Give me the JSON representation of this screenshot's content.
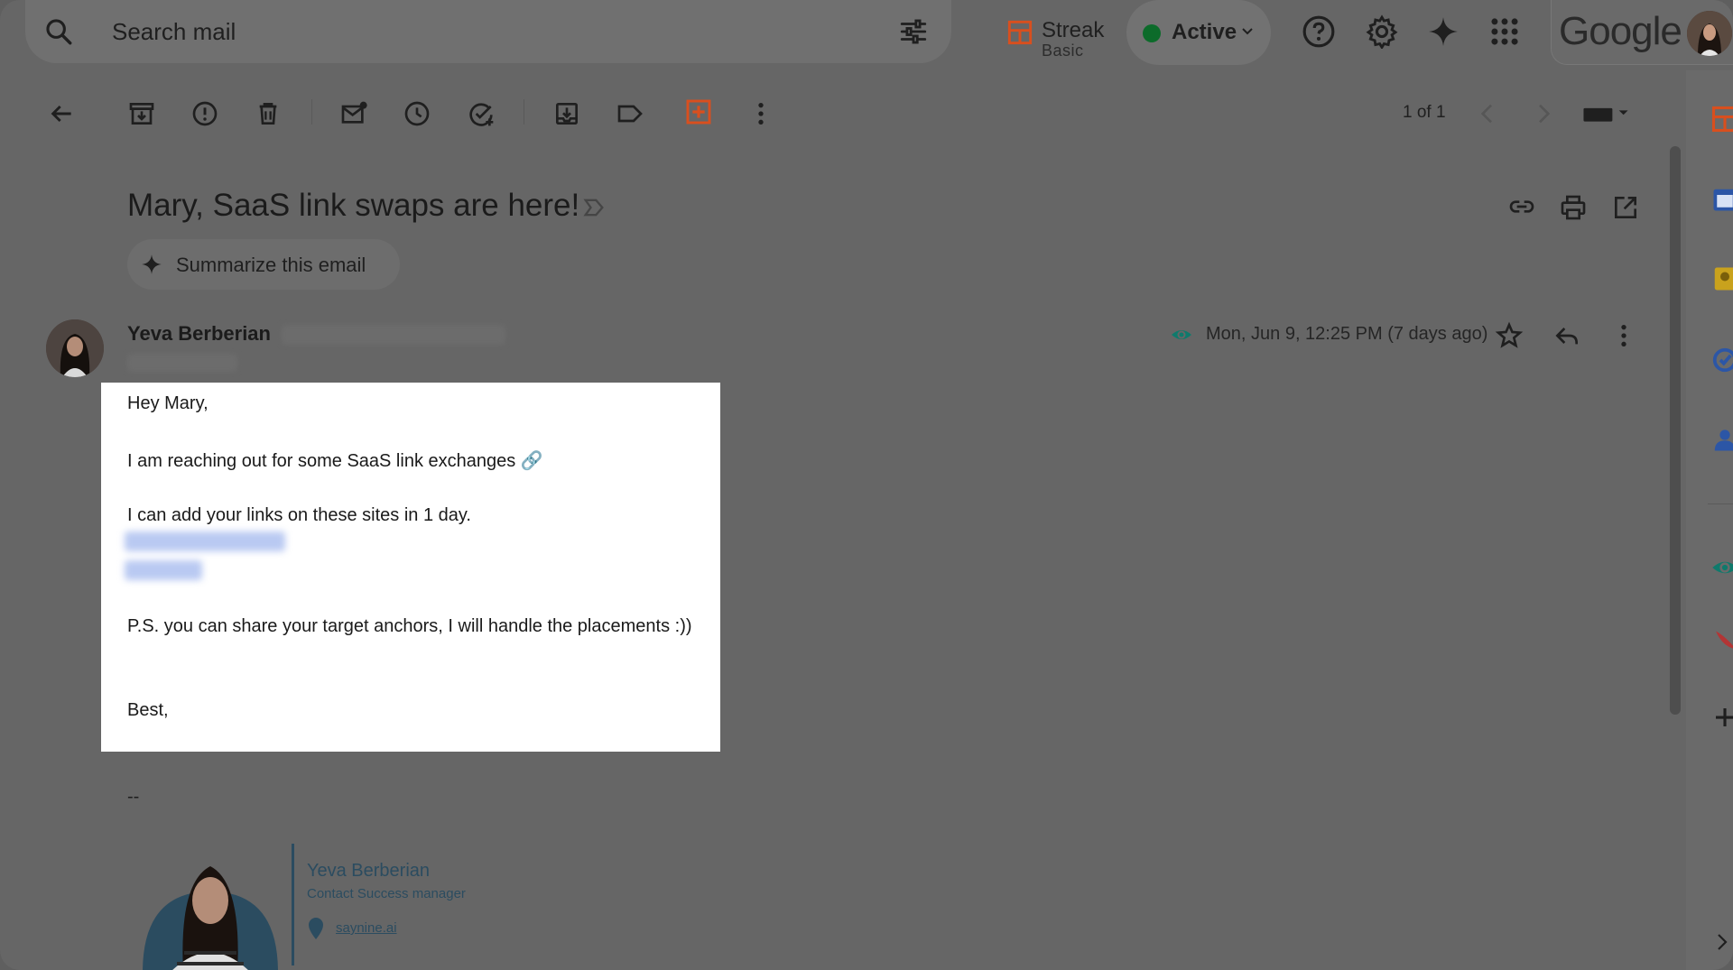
{
  "search": {
    "placeholder": "Search mail"
  },
  "streak": {
    "name": "Streak",
    "tier": "Basic"
  },
  "status": {
    "label": "Active"
  },
  "google": {
    "wordmark": "Google"
  },
  "toolbar": {
    "pager": "1 of 1"
  },
  "email": {
    "subject": "Mary, SaaS link swaps are here!",
    "summarize_label": "Summarize this email",
    "sender_name": "Yeva Berberian",
    "date": "Mon, Jun 9, 12:25 PM (7 days ago)",
    "body": {
      "greeting": "Hey Mary,",
      "line1": "I am reaching out for some SaaS link exchanges 🔗",
      "line2": "I can add your links on these sites in 1 day.",
      "ps": "P.S. you can share your target anchors, I will handle the placements :))",
      "closing": "Best,"
    },
    "signature": {
      "separator": "--",
      "name": "Yeva Berberian",
      "role": "Contact Success manager",
      "link": "saynine.ai"
    }
  },
  "colors": {
    "streak_orange": "#d94f1e",
    "status_green": "#0c6b2a",
    "signature_blue": "#2b4c60",
    "eye_teal": "#0f7a6c"
  }
}
